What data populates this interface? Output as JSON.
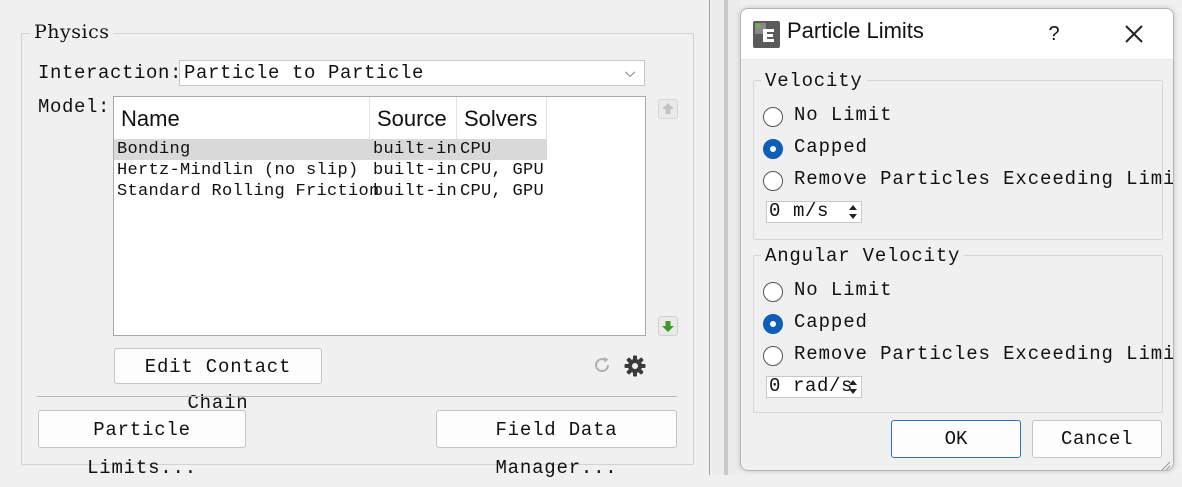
{
  "physics": {
    "title": "Physics",
    "interaction_label": "Interaction:",
    "interaction_value": "Particle to Particle",
    "model_label": "Model:",
    "table": {
      "headers": [
        "Name",
        "Source",
        "Solvers"
      ],
      "rows": [
        {
          "name": "Bonding",
          "source": "built-in",
          "solvers": "CPU",
          "selected": true
        },
        {
          "name": "Hertz-Mindlin (no slip)",
          "source": "built-in",
          "solvers": "CPU, GPU",
          "selected": false
        },
        {
          "name": "Standard Rolling Friction",
          "source": "built-in",
          "solvers": "CPU, GPU",
          "selected": false
        }
      ]
    },
    "edit_contact_chain": "Edit Contact Chain",
    "particle_limits": "Particle Limits...",
    "field_data_manager": "Field Data Manager..."
  },
  "dialog": {
    "title": "Particle Limits",
    "help": "?",
    "velocity": {
      "title": "Velocity",
      "options": [
        "No Limit",
        "Capped",
        "Remove Particles Exceeding Limit"
      ],
      "selected_index": 1,
      "value": "0 m/s"
    },
    "angular_velocity": {
      "title": "Angular Velocity",
      "options": [
        "No Limit",
        "Capped",
        "Remove Particles Exceeding Limit"
      ],
      "selected_index": 1,
      "value": "0 rad/s"
    },
    "ok": "OK",
    "cancel": "Cancel"
  },
  "icons": {
    "up": "arrow-up-icon",
    "down": "arrow-down-icon",
    "refresh": "refresh-icon",
    "settings": "gear-icon",
    "app": "app-logo-icon",
    "close": "close-icon"
  },
  "colors": {
    "accent": "#0f5fb8",
    "down_arrow": "#3d9a2a",
    "selection": "#d9d9d9"
  }
}
